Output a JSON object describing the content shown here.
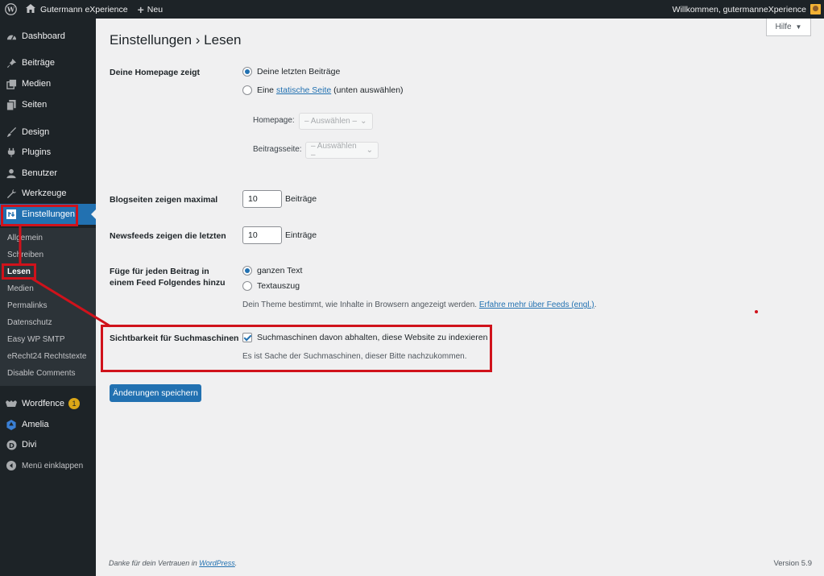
{
  "admin_bar": {
    "site_name": "Gutermann eXperience",
    "new_label": "Neu",
    "greeting": "Willkommen, gutermanneXperience"
  },
  "sidebar": {
    "menu": [
      {
        "label": "Dashboard",
        "icon": "dashboard-icon"
      },
      {
        "label": "Beiträge",
        "icon": "pin-icon"
      },
      {
        "label": "Medien",
        "icon": "media-icon"
      },
      {
        "label": "Seiten",
        "icon": "page-icon"
      },
      {
        "label": "Design",
        "icon": "brush-icon"
      },
      {
        "label": "Plugins",
        "icon": "plugin-icon"
      },
      {
        "label": "Benutzer",
        "icon": "user-icon"
      },
      {
        "label": "Werkzeuge",
        "icon": "wrench-icon"
      },
      {
        "label": "Einstellungen",
        "icon": "settings-icon"
      }
    ],
    "submenu": [
      "Allgemein",
      "Schreiben",
      "Lesen",
      "Medien",
      "Permalinks",
      "Datenschutz",
      "Easy WP SMTP",
      "eRecht24 Rechtstexte",
      "Disable Comments"
    ],
    "plugins": [
      {
        "label": "Wordfence",
        "badge": "1"
      },
      {
        "label": "Amelia"
      },
      {
        "label": "Divi"
      }
    ],
    "collapse_label": "Menü einklappen"
  },
  "help_tab": "Hilfe",
  "page_title": "Einstellungen › Lesen",
  "homepage": {
    "label": "Deine Homepage zeigt",
    "option_posts": "Deine letzten Beiträge",
    "option_static_prefix": "Eine",
    "option_static_link": "statische Seite",
    "option_static_suffix": "(unten auswählen)",
    "homepage_label": "Homepage:",
    "posts_page_label": "Beitragsseite:",
    "select_placeholder": "– Auswählen –"
  },
  "blog_pages": {
    "label": "Blogseiten zeigen maximal",
    "value": "10",
    "unit": "Beiträge"
  },
  "feeds": {
    "label": "Newsfeeds zeigen die letzten",
    "value": "10",
    "unit": "Einträge"
  },
  "feed_content": {
    "label_line1": "Füge für jeden Beitrag in",
    "label_line2": "einem Feed Folgendes hinzu",
    "option_full": "ganzen Text",
    "option_excerpt": "Textauszug",
    "description": "Dein Theme bestimmt, wie Inhalte in Browsern angezeigt werden.",
    "link": "Erfahre mehr über Feeds (engl.)",
    "link_suffix": "."
  },
  "search_visibility": {
    "label": "Sichtbarkeit für Suchmaschinen",
    "checkbox_label": "Suchmaschinen davon abhalten, diese Website zu indexieren",
    "description": "Es ist Sache der Suchmaschinen, dieser Bitte nachzukommen."
  },
  "save_button": "Änderungen speichern",
  "footer": {
    "text": "Danke für dein Vertrauen in",
    "link": "WordPress",
    "suffix": ".",
    "version": "Version 5.9"
  },
  "colors": {
    "accent": "#2271b1",
    "sidebar": "#1d2327",
    "annotation": "#d0121b"
  }
}
